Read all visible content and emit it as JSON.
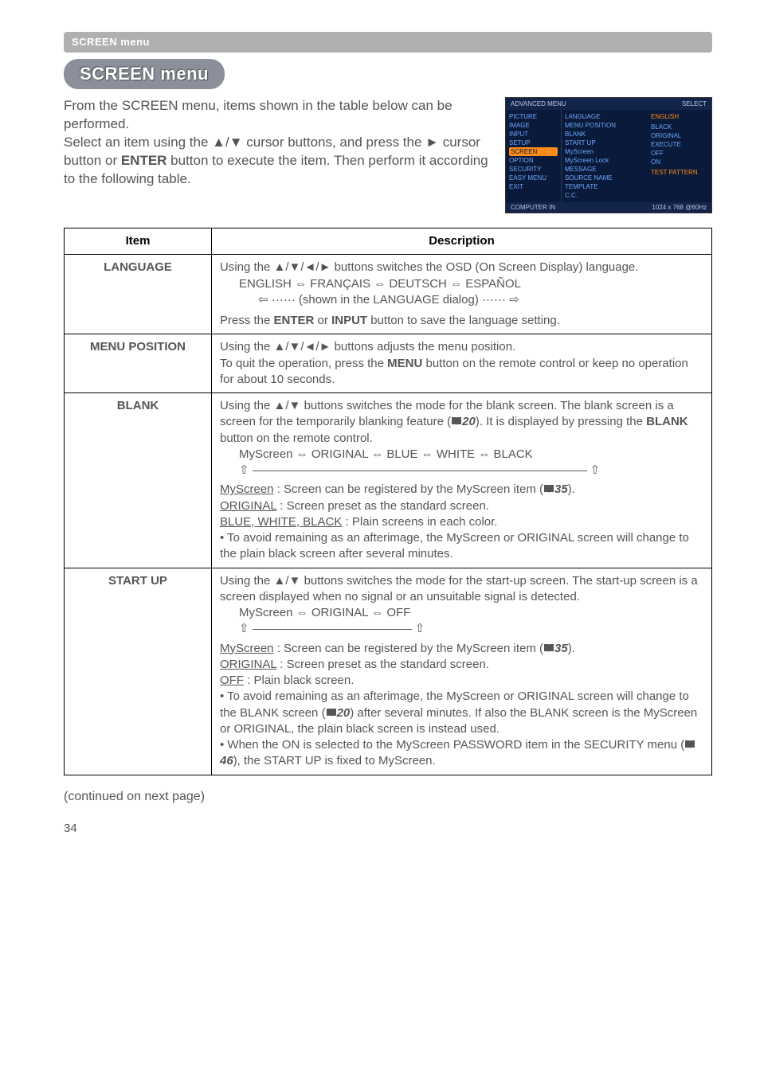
{
  "breadcrumb": "SCREEN menu",
  "title": "SCREEN menu",
  "intro": "From the SCREEN menu, items shown in the table below can be performed.\nSelect an item using the ▲/▼ cursor buttons, and press the ► cursor button or ENTER button to execute the item. Then perform it according to the following table.",
  "osd": {
    "header_left": "ADVANCED MENU",
    "header_right": "SELECT",
    "left": [
      "PICTURE",
      "IMAGE",
      "INPUT",
      "SETUP",
      "SCREEN",
      "OPTION",
      "SECURITY",
      "EASY MENU",
      "EXIT"
    ],
    "left_hl_index": 4,
    "mid": [
      "LANGUAGE",
      "MENU POSITION",
      "BLANK",
      "START UP",
      "MyScreen",
      "MyScreen Lock",
      "MESSAGE",
      "SOURCE NAME",
      "TEMPLATE",
      "C.C."
    ],
    "right": [
      "ENGLISH",
      "",
      "BLACK",
      "ORIGINAL",
      "EXECUTE",
      "OFF",
      "ON",
      "",
      "TEST PATTERN",
      ""
    ],
    "footer_left": "COMPUTER IN",
    "footer_right": "1024 x 768 @60Hz"
  },
  "table": {
    "head_item": "Item",
    "head_desc": "Description",
    "rows": [
      {
        "label": "LANGUAGE",
        "p1": "Using the ▲/▼/◄/► buttons switches the OSD (On Screen Display) language.",
        "seq": "ENGLISH ⇔ FRANÇAIS ⇔ DEUTSCH ⇔  ESPAÑOL",
        "seq_sub": "⇦ ······ (shown in the LANGUAGE dialog) ······ ⇨",
        "p2_a": "Press the ",
        "p2_b": "ENTER",
        "p2_c": " or ",
        "p2_d": "INPUT",
        "p2_e": " button to save the language setting."
      },
      {
        "label": "MENU POSITION",
        "p1": "Using the ▲/▼/◄/► buttons adjusts the menu position.",
        "p2_a": "To quit the operation, press the ",
        "p2_b": "MENU",
        "p2_c": " button on the remote control or keep no operation for about 10 seconds."
      },
      {
        "label": "BLANK",
        "p1": "Using the ▲/▼ buttons switches the mode for the blank screen. The blank screen is a screen for the temporarily blanking feature (",
        "ref1": "20",
        "p1b": "). It is displayed by pressing the ",
        "p1c": "BLANK",
        "p1d": " button on the remote control.",
        "seq": "MyScreen ⇔ ORIGINAL ⇔ BLUE ⇔ WHITE ⇔ BLACK",
        "u1": "MyScreen",
        "u1_rest": " : Screen can be registered by the MyScreen item (",
        "ref2": "35",
        "u1_end": ").",
        "u2": "ORIGINAL",
        "u2_rest": " : Screen preset as the standard screen.",
        "u3": "BLUE, WHITE, BLACK",
        "u3_rest": " : Plain screens in each color.",
        "bullet": "• To avoid remaining as an afterimage, the MyScreen or ORIGINAL screen will change to the plain black screen after several minutes."
      },
      {
        "label": "START UP",
        "p1": "Using the ▲/▼ buttons switches the mode for the start-up screen. The start-up screen is a screen displayed when no signal or an unsuitable signal is detected.",
        "seq": "MyScreen ⇔ ORIGINAL ⇔ OFF",
        "u1": "MyScreen",
        "u1_rest": " : Screen can be registered by the MyScreen item (",
        "ref1": "35",
        "u1_end": ").",
        "u2": "ORIGINAL",
        "u2_rest": " : Screen preset as the standard screen.",
        "u3": "OFF",
        "u3_rest": " : Plain black screen.",
        "b1a": "• To avoid remaining as an afterimage, the MyScreen or ORIGINAL screen will change to the BLANK screen (",
        "ref2": "20",
        "b1b": ") after several minutes. If also the BLANK screen is the MyScreen or ORIGINAL, the plain black screen is instead used.",
        "b2a": "• When the ON is selected to the MyScreen PASSWORD item in the SECURITY menu (",
        "ref3": "46",
        "b2b": "), the START UP is fixed to MyScreen."
      }
    ]
  },
  "cont": "(continued on next page)",
  "pageno": "34"
}
